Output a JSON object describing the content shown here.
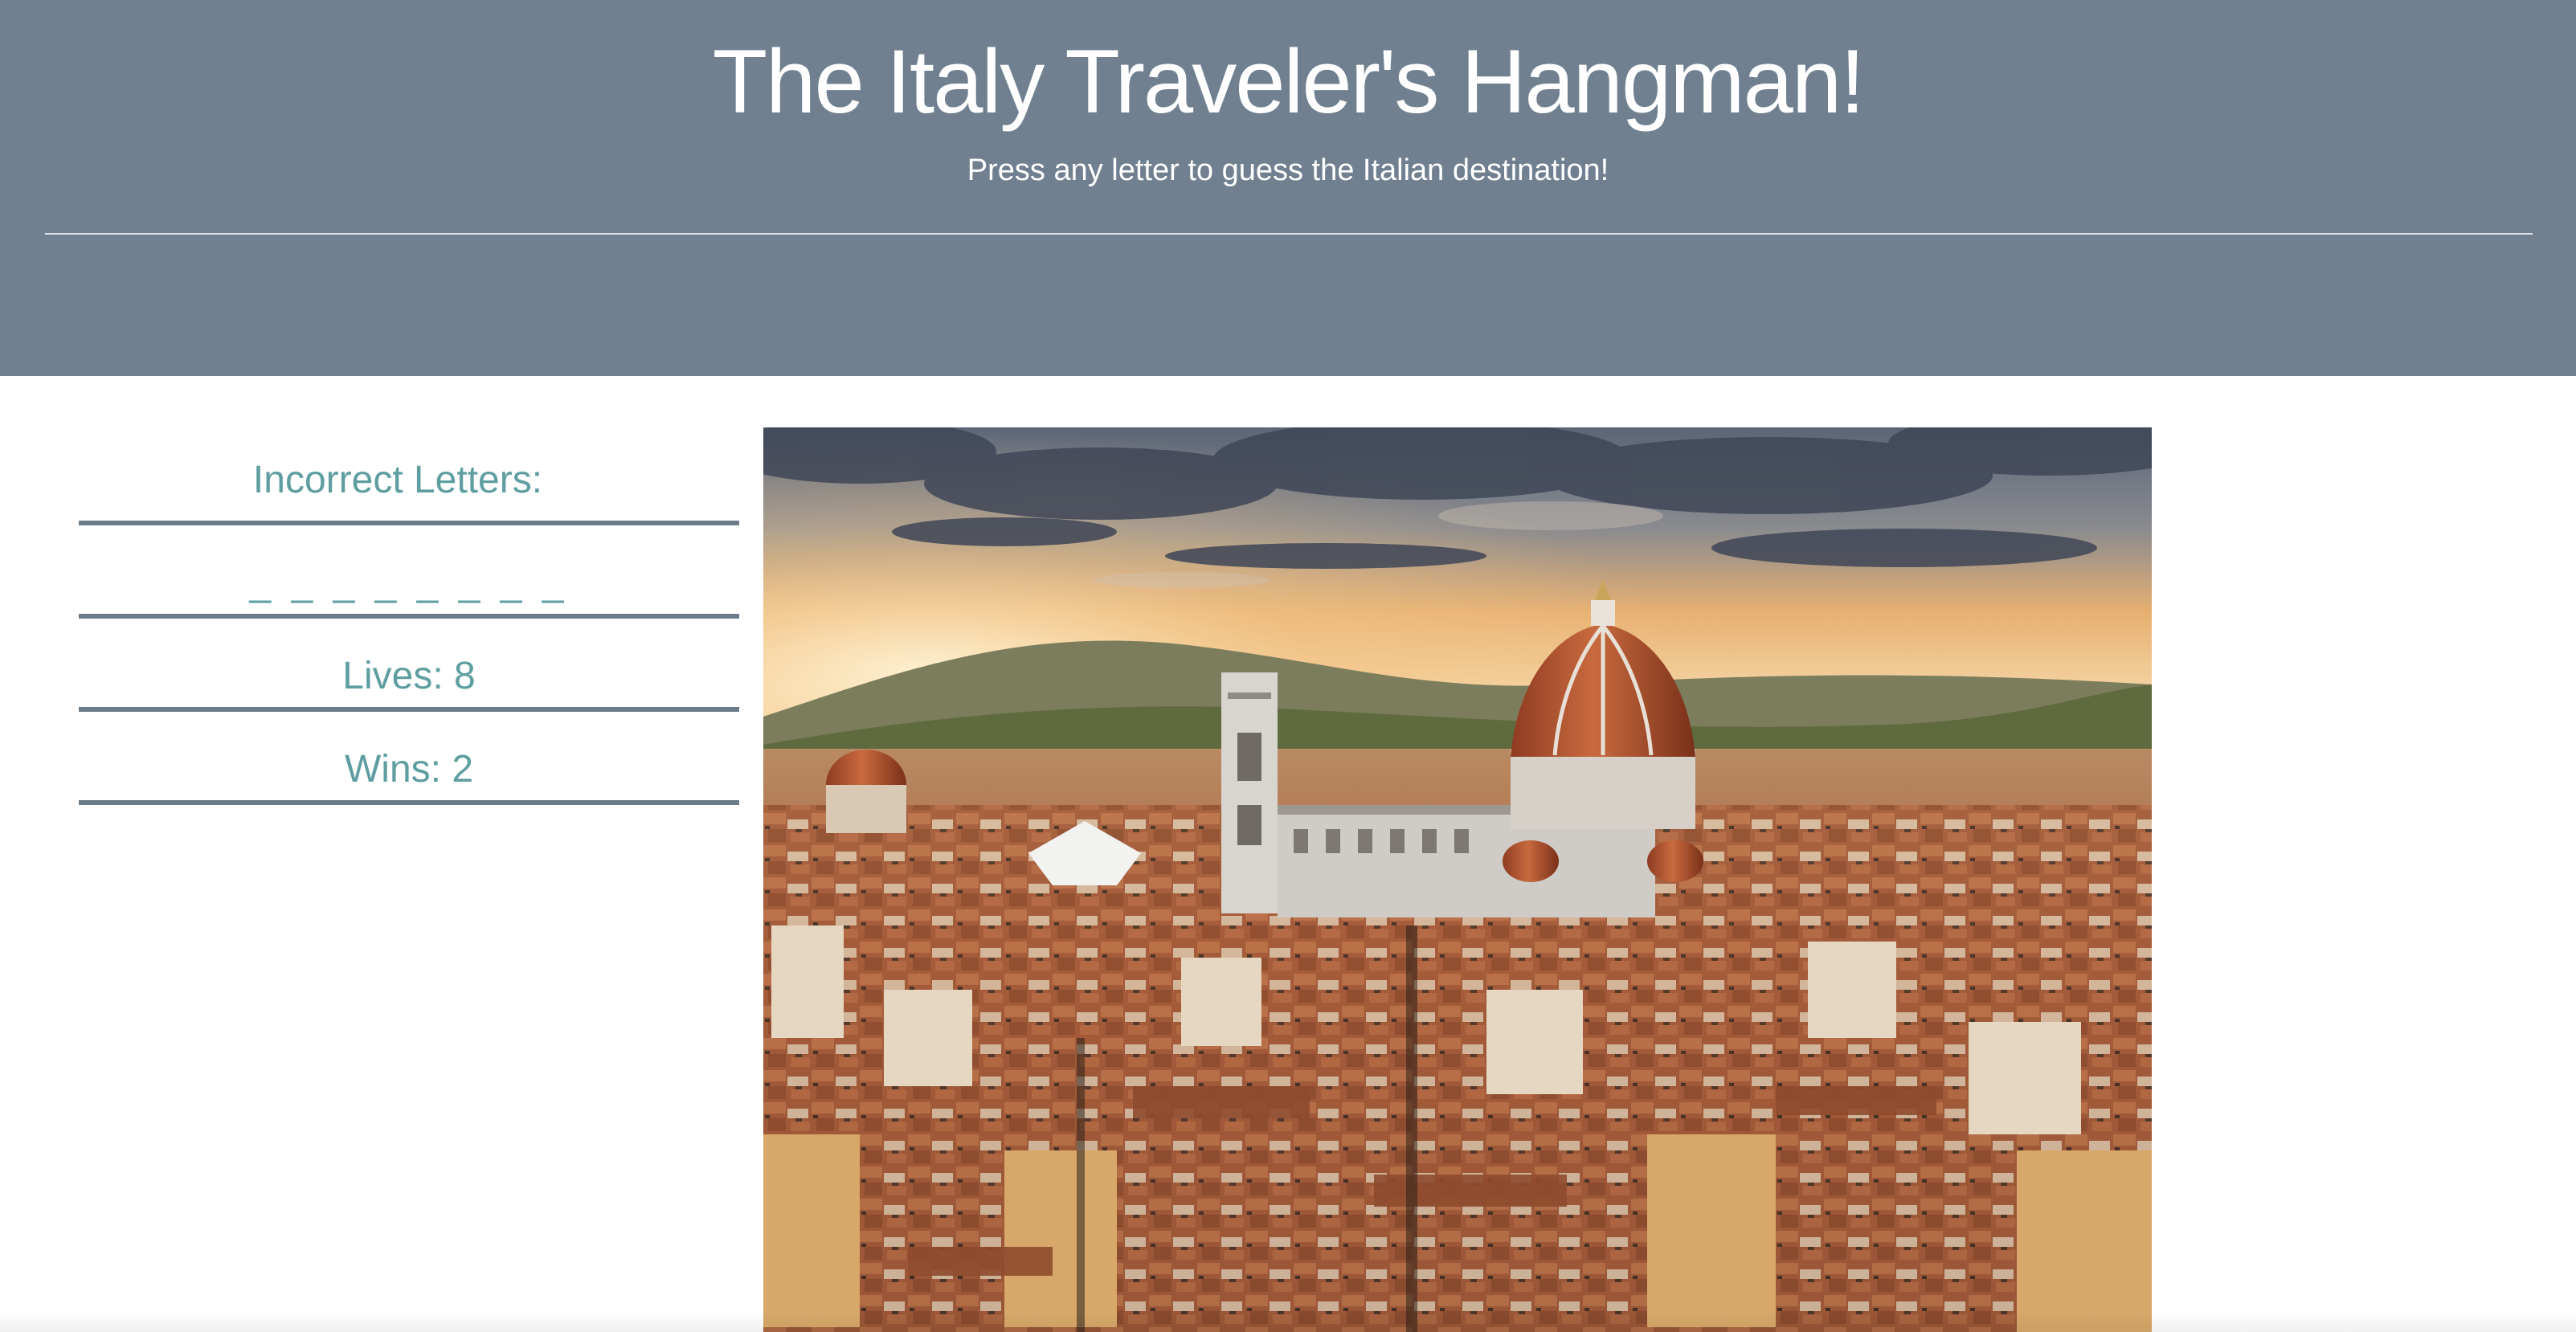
{
  "header": {
    "title": "The Italy Traveler's Hangman!",
    "subtitle": "Press any letter to guess the Italian destination!",
    "background_color": "#708090"
  },
  "game": {
    "incorrect_letters_label": "Incorrect Letters:",
    "word_blanks": "_ _ _ _ _ _ _ _",
    "lives_text": "Lives: 8",
    "wins_text": "Wins: 2",
    "text_color": "#5f9ea0"
  },
  "image": {
    "icon": "florence-cityscape-photo"
  }
}
